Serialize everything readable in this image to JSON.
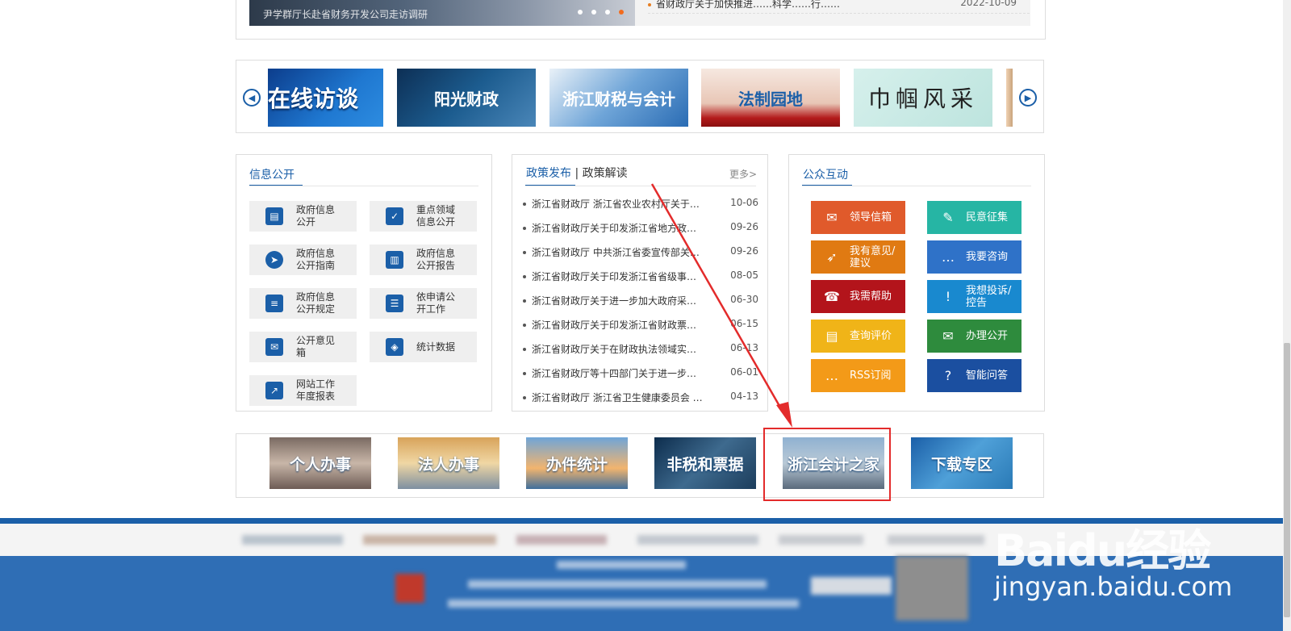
{
  "top": {
    "banner_caption": "尹学群厅长赴省财务开发公司走访调研",
    "news_title": "省财政厅关于加快推进……科学……行……",
    "news_date": "2022-10-09"
  },
  "carousel": {
    "tiles": [
      "在线访谈",
      "阳光财政",
      "浙江财税与会计",
      "法制园地",
      "巾帼风采"
    ]
  },
  "info_open": {
    "title": "信息公开",
    "items": [
      {
        "label": "政府信息公开",
        "icon": "document-icon"
      },
      {
        "label": "重点领域信息公开",
        "icon": "check-list-icon"
      },
      {
        "label": "政府信息公开指南",
        "icon": "compass-icon"
      },
      {
        "label": "政府信息公开报告",
        "icon": "report-icon"
      },
      {
        "label": "政府信息公开规定",
        "icon": "rule-doc-icon"
      },
      {
        "label": "依申请公开工作",
        "icon": "request-doc-icon"
      },
      {
        "label": "公开意见箱",
        "icon": "mailbox-icon"
      },
      {
        "label": "统计数据",
        "icon": "layers-icon"
      },
      {
        "label": "网站工作年度报表",
        "icon": "chart-icon"
      }
    ]
  },
  "policy": {
    "tab_release": "政策发布",
    "tab_sep": "|",
    "tab_interpret": "政策解读",
    "more": "更多>",
    "items": [
      {
        "title": "浙江省财政厅 浙江省农业农村厅关于…",
        "date": "10-06"
      },
      {
        "title": "浙江省财政厅关于印发浙江省地方政…",
        "date": "09-26"
      },
      {
        "title": "浙江省财政厅 中共浙江省委宣传部关…",
        "date": "09-26"
      },
      {
        "title": "浙江省财政厅关于印发浙江省省级事…",
        "date": "08-05"
      },
      {
        "title": "浙江省财政厅关于进一步加大政府采…",
        "date": "06-30"
      },
      {
        "title": "浙江省财政厅关于印发浙江省财政票…",
        "date": "06-15"
      },
      {
        "title": "浙江省财政厅关于在财政执法领域实…",
        "date": "06-13"
      },
      {
        "title": "浙江省财政厅等十四部门关于进一步…",
        "date": "06-01"
      },
      {
        "title": "浙江省财政厅 浙江省卫生健康委员会 …",
        "date": "04-13"
      }
    ]
  },
  "public": {
    "title": "公众互动",
    "items": [
      {
        "label": "领导信箱",
        "color": "#e05a2b",
        "icon": "mail-open-icon"
      },
      {
        "label": "民意征集",
        "color": "#26b5a4",
        "icon": "pen-icon"
      },
      {
        "label": "我有意见/建议",
        "color": "#e07a12",
        "icon": "paper-plane-icon"
      },
      {
        "label": "我要咨询",
        "color": "#2f72c8",
        "icon": "chat-icon"
      },
      {
        "label": "我需帮助",
        "color": "#b3141b",
        "icon": "phone-icon"
      },
      {
        "label": "我想投诉/控告",
        "color": "#1989cf",
        "icon": "alert-icon"
      },
      {
        "label": "查询评价",
        "color": "#f0b418",
        "icon": "search-doc-icon"
      },
      {
        "label": "办理公开",
        "color": "#2e8b3d",
        "icon": "envelope-icon"
      },
      {
        "label": "RSS订阅",
        "color": "#f39a18",
        "icon": "rss-chat-icon"
      },
      {
        "label": "智能问答",
        "color": "#1b4fa0",
        "icon": "question-icon"
      }
    ]
  },
  "services": [
    "个人办事",
    "法人办事",
    "办件统计",
    "非税和票据",
    "浙江会计之家",
    "下载专区"
  ],
  "watermark": {
    "brand": "Baidu经验",
    "url": "jingyan.baidu.com"
  }
}
